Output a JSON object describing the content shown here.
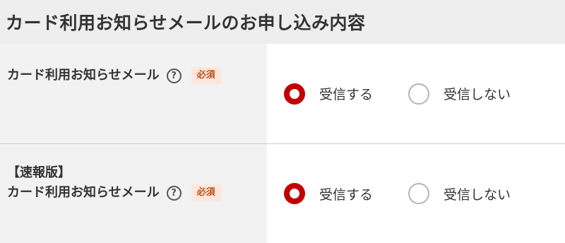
{
  "section": {
    "title": "カード利用お知らせメールのお申し込み内容"
  },
  "rows": [
    {
      "label": "カード利用お知らせメール",
      "help_icon": "question-circle-icon",
      "required": "必須",
      "options": [
        {
          "label": "受信する",
          "selected": true
        },
        {
          "label": "受信しない",
          "selected": false
        }
      ]
    },
    {
      "label_prefix": "【速報版】",
      "label": "カード利用お知らせメール",
      "help_icon": "question-circle-icon",
      "required": "必須",
      "options": [
        {
          "label": "受信する",
          "selected": true
        },
        {
          "label": "受信しない",
          "selected": false
        }
      ]
    }
  ],
  "colors": {
    "accent": "#c00000",
    "badge_bg": "#fde7dd",
    "badge_text": "#c0501c",
    "header_bg": "#eeeeee",
    "label_bg": "#f2f2f2"
  }
}
